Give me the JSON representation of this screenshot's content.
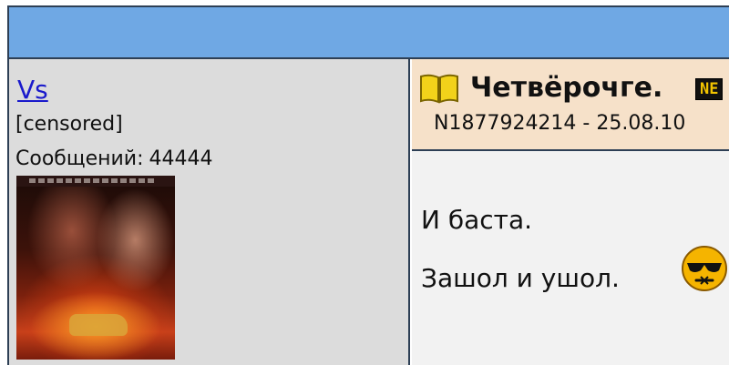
{
  "user": {
    "name": "Vs",
    "status": "[censored]",
    "posts_label": "Сообщений:",
    "posts_count": "44444"
  },
  "post": {
    "title": "Четвёрочге.",
    "badge": "NE",
    "meta": "N1877924214 - 25.08.10",
    "lines": [
      "И баста.",
      "Зашол и ушол."
    ],
    "separator": "----------------------"
  },
  "icons": {
    "post_icon": "open-book-icon",
    "smiley": "sunglasses-smiley-icon"
  },
  "colors": {
    "header_bar": "#6fa8e4",
    "user_panel": "#dcdcdc",
    "post_header": "#f6e1c9",
    "post_body": "#f2f2f2",
    "link": "#1a1acc",
    "border": "#2d3f55"
  }
}
